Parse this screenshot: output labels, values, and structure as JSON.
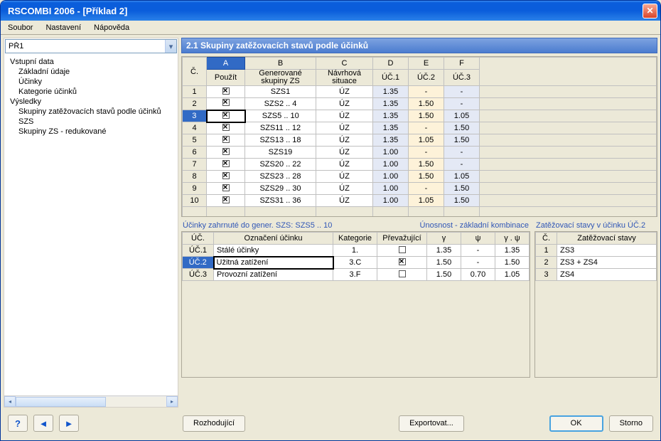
{
  "window": {
    "title": "RSCOMBI 2006 - [Příklad 2]"
  },
  "menu": {
    "items": [
      "Soubor",
      "Nastavení",
      "Nápověda"
    ]
  },
  "combo": {
    "value": "PŘ1"
  },
  "tree": {
    "group1": "Vstupní data",
    "g1_items": [
      "Základní údaje",
      "Účinky",
      "Kategorie účinků"
    ],
    "group2": "Výsledky",
    "g2_items": [
      "Skupiny zatěžovacích stavů podle účinků",
      "SZS",
      "Skupiny ZS - redukované"
    ]
  },
  "section": {
    "title": "2.1 Skupiny zatěžovacích stavů podle účinků"
  },
  "main_cols_letters": [
    "A",
    "B",
    "C",
    "D",
    "E",
    "F"
  ],
  "main_cols": {
    "num": "Č.",
    "A": "Použít",
    "B": "Generované\nskupiny ZS",
    "C": "Návrhová\nsituace",
    "D": "ÚČ.1",
    "E": "ÚČ.2",
    "F": "ÚČ.3"
  },
  "main_rows": [
    {
      "n": "1",
      "use": true,
      "b": "SZS1",
      "c": "ÚZ",
      "d": "1.35",
      "e": "-",
      "f": "-"
    },
    {
      "n": "2",
      "use": true,
      "b": "SZS2 .. 4",
      "c": "ÚZ",
      "d": "1.35",
      "e": "1.50",
      "f": "-"
    },
    {
      "n": "3",
      "use": true,
      "b": "SZS5 .. 10",
      "c": "ÚZ",
      "d": "1.35",
      "e": "1.50",
      "f": "1.05",
      "sel": true
    },
    {
      "n": "4",
      "use": true,
      "b": "SZS11 .. 12",
      "c": "ÚZ",
      "d": "1.35",
      "e": "-",
      "f": "1.50"
    },
    {
      "n": "5",
      "use": true,
      "b": "SZS13 .. 18",
      "c": "ÚZ",
      "d": "1.35",
      "e": "1.05",
      "f": "1.50"
    },
    {
      "n": "6",
      "use": true,
      "b": "SZS19",
      "c": "ÚZ",
      "d": "1.00",
      "e": "-",
      "f": "-"
    },
    {
      "n": "7",
      "use": true,
      "b": "SZS20 .. 22",
      "c": "ÚZ",
      "d": "1.00",
      "e": "1.50",
      "f": "-"
    },
    {
      "n": "8",
      "use": true,
      "b": "SZS23 .. 28",
      "c": "ÚZ",
      "d": "1.00",
      "e": "1.50",
      "f": "1.05"
    },
    {
      "n": "9",
      "use": true,
      "b": "SZS29 .. 30",
      "c": "ÚZ",
      "d": "1.00",
      "e": "-",
      "f": "1.50"
    },
    {
      "n": "10",
      "use": true,
      "b": "SZS31 .. 36",
      "c": "ÚZ",
      "d": "1.00",
      "e": "1.05",
      "f": "1.50"
    }
  ],
  "effects_panel": {
    "title_left": "Účinky zahrnuté do gener. SZS: SZS5 .. 10",
    "title_right": "Únosnost - základní kombinace",
    "cols": {
      "uc": "ÚČ.",
      "name": "Označení účinku",
      "cat": "Kategorie",
      "prev": "Převažující",
      "y": "γ",
      "psi": "ψ",
      "ypsi": "γ . ψ"
    },
    "rows": [
      {
        "uc": "ÚČ.1",
        "name": "Stálé účinky",
        "cat": "1.",
        "prev": false,
        "y": "1.35",
        "psi": "-",
        "ypsi": "1.35"
      },
      {
        "uc": "ÚČ.2",
        "name": "Užitná zatížení",
        "cat": "3.C",
        "prev": true,
        "y": "1.50",
        "psi": "-",
        "ypsi": "1.50",
        "sel": true
      },
      {
        "uc": "ÚČ.3",
        "name": "Provozní zatížení",
        "cat": "3.F",
        "prev": false,
        "y": "1.50",
        "psi": "0.70",
        "ypsi": "1.05"
      }
    ]
  },
  "loads_panel": {
    "title": "Zatěžovací stavy v účinku ÚČ.2",
    "cols": {
      "num": "Č.",
      "name": "Zatěžovací stavy"
    },
    "rows": [
      {
        "n": "1",
        "name": "ZS3"
      },
      {
        "n": "2",
        "name": "ZS3 + ZS4"
      },
      {
        "n": "3",
        "name": "ZS4"
      }
    ]
  },
  "buttons": {
    "help": "?",
    "rozhodujici": "Rozhodující",
    "export": "Exportovat...",
    "ok": "OK",
    "storno": "Storno"
  }
}
